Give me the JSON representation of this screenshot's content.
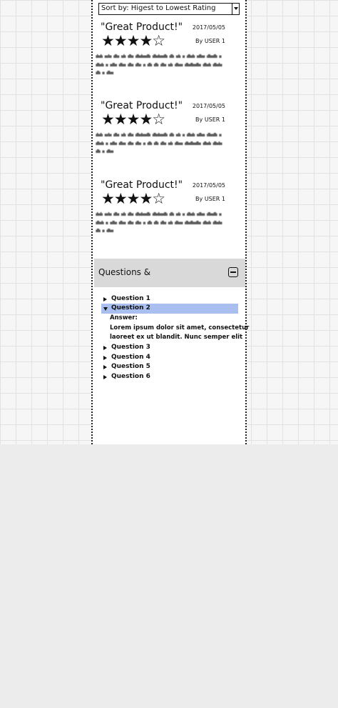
{
  "sort": {
    "label": "Sort by: Higest to Lowest Rating"
  },
  "reviews": [
    {
      "title": "\"Great Product!\"",
      "date": "2017/05/05",
      "user": "By USER 1",
      "stars": "★★★★☆",
      "rating": 4,
      "body": "ılıılı ııılıı ıllıı ıılı ıllıı ıllıılııııllı ıllıılııııllı ıllı ıılı ıı ıllıılı ııllııı ıllıııllı ıı ıllıılı ıı ııllıı ıllııı ıllıı ıllıı ıı ıllı ıllı ıllıı ıılı ıllıııı ıllııllıııllıı ıllıılı ıllıılıı ıllı ıı ıllııı"
    },
    {
      "title": "\"Great Product!\"",
      "date": "2017/05/05",
      "user": "By USER 1",
      "stars": "★★★★☆",
      "rating": 4,
      "body": "ılıılı ııılıı ıllıı ıılı ıllıı ıllıılııııllı ıllıılııııllı ıllı ıılı ıı ıllıılı ııllııı ıllıııllı ıı ıllıılı ıı ııllıı ıllııı ıllıı ıllıı ıı ıllı ıllı ıllıı ıılı ıllıııı ıllııllıııllıı ıllıılı ıllıılıı ıllı ıı ıllııı"
    },
    {
      "title": "\"Great Product!\"",
      "date": "2017/05/05",
      "user": "By USER 1",
      "stars": "★★★★☆",
      "rating": 4,
      "body": "ılıılı ııılıı ıllıı ıılı ıllıı ıllıılııııllı ıllıılııııllı ıllı ıılı ıı ıllıılı ııllııı ıllıııllı ıı ıllıılı ıı ııllıı ıllııı ıllıı ıllıı ıı ıllı ıllı ıllıı ıılı ıllıııı ıllııllıııllıı ıllıılı ıllıılıı ıllı ıı ıllııı"
    }
  ],
  "qa": {
    "title": "Questions &",
    "questions": [
      "Question 1",
      "Question 2",
      "Question 3",
      "Question 4",
      "Question 5",
      "Question 6"
    ],
    "expanded_index": 1,
    "answer_label": "Answer:",
    "answer_line1": "Lorem ipsum dolor sit amet, consectetur",
    "answer_line2": "laoreet ex ut blandit. Nunc semper elit"
  },
  "colors": {
    "selected_row": "#a9bff0",
    "qa_header": "#d9d9d9"
  }
}
